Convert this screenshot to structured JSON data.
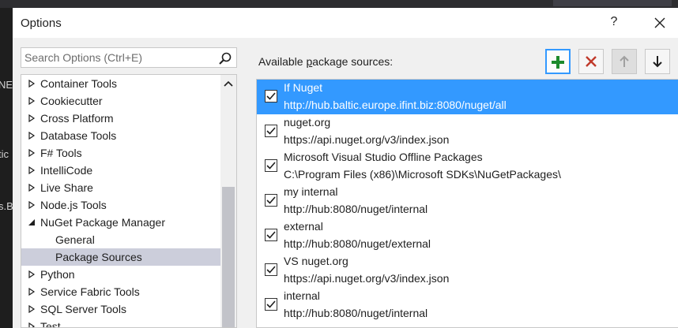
{
  "background": {
    "left_fragments": [
      "NE",
      "tic",
      "s.B"
    ]
  },
  "dialog": {
    "title": "Options",
    "help_label": "?",
    "close_icon": "close-icon"
  },
  "search": {
    "placeholder": "Search Options (Ctrl+E)",
    "icon": "search-icon"
  },
  "tree": {
    "items": [
      {
        "label": "Container Tools",
        "expanded": false,
        "level": 0,
        "selected": false
      },
      {
        "label": "Cookiecutter",
        "expanded": false,
        "level": 0,
        "selected": false
      },
      {
        "label": "Cross Platform",
        "expanded": false,
        "level": 0,
        "selected": false
      },
      {
        "label": "Database Tools",
        "expanded": false,
        "level": 0,
        "selected": false
      },
      {
        "label": "F# Tools",
        "expanded": false,
        "level": 0,
        "selected": false
      },
      {
        "label": "IntelliCode",
        "expanded": false,
        "level": 0,
        "selected": false
      },
      {
        "label": "Live Share",
        "expanded": false,
        "level": 0,
        "selected": false
      },
      {
        "label": "Node.js Tools",
        "expanded": false,
        "level": 0,
        "selected": false
      },
      {
        "label": "NuGet Package Manager",
        "expanded": true,
        "level": 0,
        "selected": false
      },
      {
        "label": "General",
        "expanded": null,
        "level": 1,
        "selected": false
      },
      {
        "label": "Package Sources",
        "expanded": null,
        "level": 1,
        "selected": true
      },
      {
        "label": "Python",
        "expanded": false,
        "level": 0,
        "selected": false
      },
      {
        "label": "Service Fabric Tools",
        "expanded": false,
        "level": 0,
        "selected": false
      },
      {
        "label": "SQL Server Tools",
        "expanded": false,
        "level": 0,
        "selected": false
      },
      {
        "label": "Test",
        "expanded": false,
        "level": 0,
        "selected": false
      }
    ]
  },
  "panel": {
    "label_prefix": "Available ",
    "label_underlined": "p",
    "label_suffix": "ackage sources:",
    "buttons": {
      "add": "plus-icon",
      "remove": "remove-x-icon",
      "up": "arrow-up-icon",
      "down": "arrow-down-icon"
    }
  },
  "sources": [
    {
      "name": "If Nuget",
      "url": "http://hub.baltic.europe.ifint.biz:8080/nuget/all",
      "checked": true,
      "selected": true
    },
    {
      "name": "nuget.org",
      "url": "https://api.nuget.org/v3/index.json",
      "checked": true,
      "selected": false
    },
    {
      "name": "Microsoft Visual Studio Offline Packages",
      "url": "C:\\Program Files (x86)\\Microsoft SDKs\\NuGetPackages\\",
      "checked": true,
      "selected": false
    },
    {
      "name": "my internal",
      "url": "http://hub:8080/nuget/internal",
      "checked": true,
      "selected": false
    },
    {
      "name": "external",
      "url": "http://hub:8080/nuget/external",
      "checked": true,
      "selected": false
    },
    {
      "name": "VS nuget.org",
      "url": "https://api.nuget.org/v3/index.json",
      "checked": true,
      "selected": false
    },
    {
      "name": "internal",
      "url": "http://hub:8080/nuget/internal",
      "checked": true,
      "selected": false
    }
  ],
  "colors": {
    "accent": "#3399ff",
    "selected_tree": "#cccedb",
    "add_green": "#1c8a2c",
    "remove_red": "#c0392b"
  }
}
